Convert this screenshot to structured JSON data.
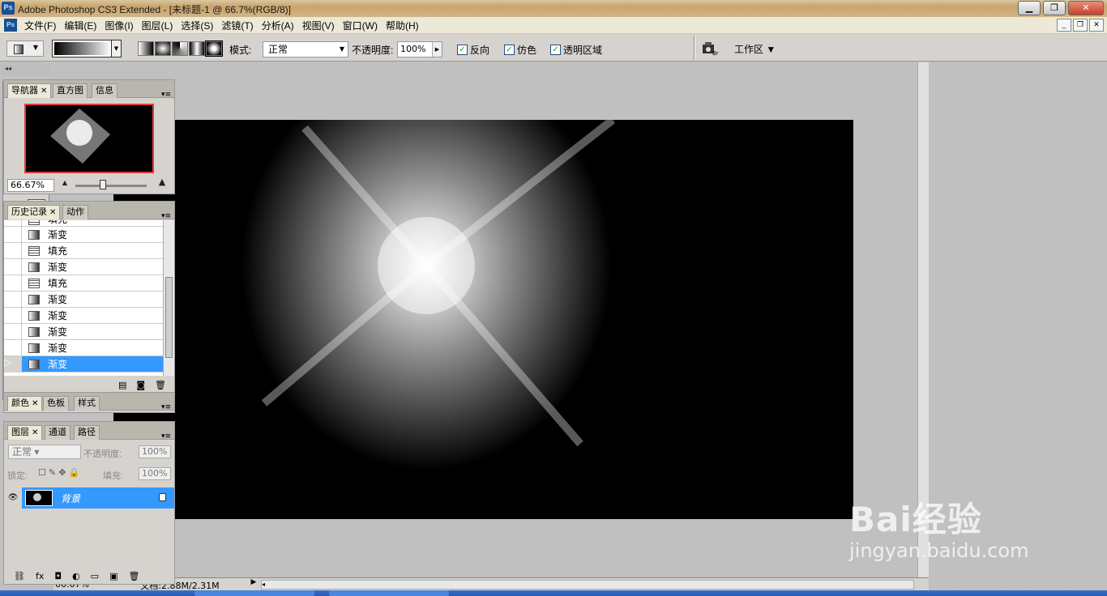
{
  "window": {
    "title": "Adobe Photoshop CS3 Extended - [未标题-1 @ 66.7%(RGB/8)]",
    "app_icon": "Ps",
    "controls": [
      "minimize",
      "maximize",
      "close"
    ]
  },
  "menu": {
    "items": [
      "文件(F)",
      "编辑(E)",
      "图像(I)",
      "图层(L)",
      "选择(S)",
      "滤镜(T)",
      "分析(A)",
      "视图(V)",
      "窗口(W)",
      "帮助(H)"
    ]
  },
  "options_bar": {
    "mode_label": "模式:",
    "mode_value": "正常",
    "opacity_label": "不透明度:",
    "opacity_value": "100%",
    "reverse_label": "反向",
    "dither_label": "仿色",
    "transparency_label": "透明区域",
    "reverse_checked": true,
    "dither_checked": true,
    "transparency_checked": true,
    "workspace_label": "工作区"
  },
  "toolbox": {
    "logo": "Ps",
    "foreground_color": "#000000",
    "background_color": "#ffffff"
  },
  "canvas": {
    "background": "#000000",
    "gradient_type": "diamond",
    "gradient_from": "#ffffff",
    "gradient_to": "#000000"
  },
  "status": {
    "zoom": "66.67%",
    "doc_info": "文档:2.88M/2.31M"
  },
  "navigator": {
    "tabs": [
      "导航器",
      "直方图",
      "信息"
    ],
    "zoom_value": "66.67%"
  },
  "history": {
    "tabs": [
      "历史记录",
      "动作"
    ],
    "partial_first": "填充",
    "items": [
      {
        "label": "渐变",
        "type": "gradient"
      },
      {
        "label": "填充",
        "type": "fill"
      },
      {
        "label": "渐变",
        "type": "gradient"
      },
      {
        "label": "填充",
        "type": "fill"
      },
      {
        "label": "渐变",
        "type": "gradient"
      },
      {
        "label": "渐变",
        "type": "gradient"
      },
      {
        "label": "渐变",
        "type": "gradient"
      },
      {
        "label": "渐变",
        "type": "gradient"
      },
      {
        "label": "渐变",
        "type": "gradient",
        "selected": true
      }
    ]
  },
  "color_panel": {
    "tabs": [
      "颜色",
      "色板",
      "样式"
    ]
  },
  "layers": {
    "tabs": [
      "图层",
      "通道",
      "路径"
    ],
    "blend_mode": "正常",
    "opacity_label": "不透明度:",
    "opacity_value": "100%",
    "lock_label": "锁定:",
    "fill_label": "填充:",
    "fill_value": "100%",
    "layer_name": "背景"
  },
  "watermark": {
    "brand": "Bai经验",
    "url": "jingyan.baidu.com"
  },
  "accent_color": "#3399ff"
}
